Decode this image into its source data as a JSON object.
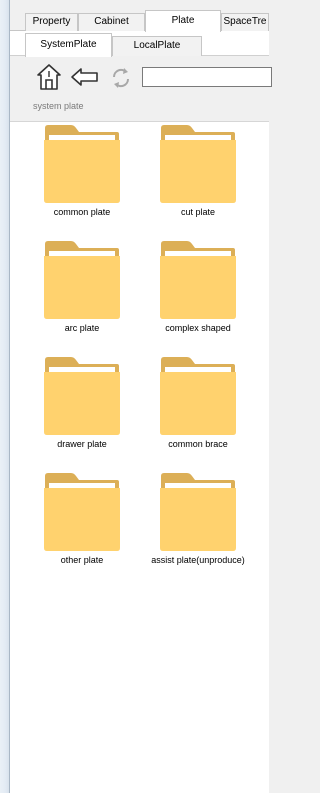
{
  "top_tabs": [
    {
      "label": "Property"
    },
    {
      "label": "Cabinet"
    },
    {
      "label": "Plate"
    },
    {
      "label": "SpaceTre"
    }
  ],
  "active_top_tab": "Plate",
  "sub_tabs": [
    {
      "label": "SystemPlate"
    },
    {
      "label": "LocalPlate"
    }
  ],
  "active_sub_tab": "SystemPlate",
  "toolbar": {
    "home_icon": "home-icon",
    "back_icon": "back-arrow-icon",
    "refresh_icon": "refresh-icon",
    "search_value": "",
    "path_label": "system plate"
  },
  "folders": [
    {
      "label": "common plate"
    },
    {
      "label": "cut plate"
    },
    {
      "label": "arc plate"
    },
    {
      "label": "complex shaped"
    },
    {
      "label": "drawer plate"
    },
    {
      "label": "common brace"
    },
    {
      "label": "other plate"
    },
    {
      "label": "assist plate(unproduce)"
    }
  ],
  "colors": {
    "folder_back": "#dcaf57",
    "folder_front": "#ffd26e",
    "folder_paper": "#ffffff"
  }
}
